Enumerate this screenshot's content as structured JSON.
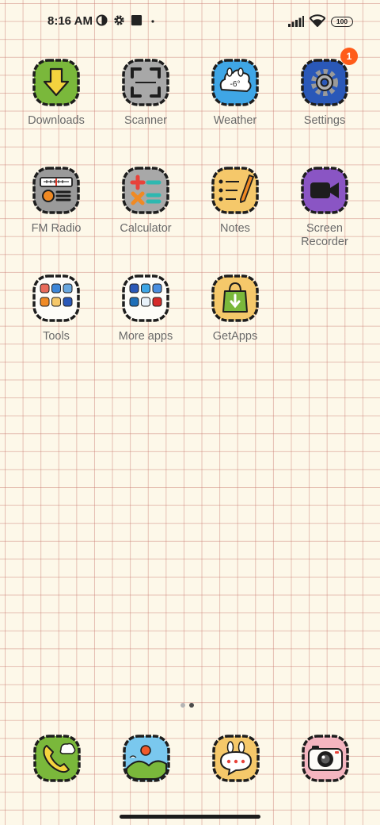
{
  "status_bar": {
    "time": "8:16 AM",
    "battery": "100",
    "icons": [
      "vpn-icon",
      "gear-icon",
      "stop-icon",
      "dot-icon",
      "signal-icon",
      "wifi-icon",
      "battery-icon"
    ]
  },
  "apps": [
    {
      "label": "Downloads",
      "icon": "downloads-icon"
    },
    {
      "label": "Scanner",
      "icon": "scanner-icon"
    },
    {
      "label": "Weather",
      "icon": "weather-icon",
      "temp": "-6°"
    },
    {
      "label": "Settings",
      "icon": "settings-icon",
      "badge": "1"
    },
    {
      "label": "FM Radio",
      "icon": "radio-icon"
    },
    {
      "label": "Calculator",
      "icon": "calculator-icon"
    },
    {
      "label": "Notes",
      "icon": "notes-icon"
    },
    {
      "label": "Screen\nRecorder",
      "icon": "screen-recorder-icon"
    },
    {
      "label": "Tools",
      "icon": "tools-folder-icon"
    },
    {
      "label": "More apps",
      "icon": "more-apps-folder-icon"
    },
    {
      "label": "GetApps",
      "icon": "getapps-icon"
    }
  ],
  "page_indicator": {
    "pages": 2,
    "current": 2
  },
  "dock": [
    "phone-icon",
    "gallery-icon",
    "messaging-icon",
    "camera-icon"
  ],
  "colors": {
    "background": "#fdf8e9",
    "grid": "#c8786e",
    "badge": "#ff5c1a",
    "label": "#6a6a6a"
  }
}
